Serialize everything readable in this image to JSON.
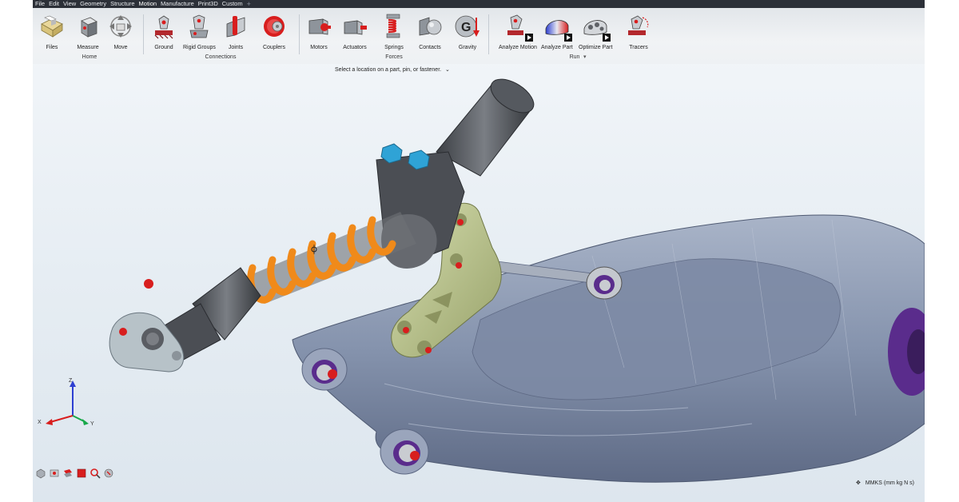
{
  "menubar": {
    "items": [
      "File",
      "Edit",
      "View",
      "Geometry",
      "Structure",
      "Motion",
      "Manufacture",
      "Print3D",
      "Custom"
    ],
    "active": "Motion"
  },
  "ribbon": {
    "home": {
      "label": "Home",
      "tools": [
        {
          "label": "Files",
          "icon": "files-icon"
        },
        {
          "label": "Measure",
          "icon": "measure-icon"
        },
        {
          "label": "Move",
          "icon": "move-icon"
        }
      ]
    },
    "connections": {
      "label": "Connections",
      "tools": [
        {
          "label": "Ground",
          "icon": "ground-icon"
        },
        {
          "label": "Rigid Groups",
          "icon": "rigid-groups-icon"
        },
        {
          "label": "Joints",
          "icon": "joints-icon"
        },
        {
          "label": "Couplers",
          "icon": "couplers-icon"
        }
      ]
    },
    "forces": {
      "label": "Forces",
      "tools": [
        {
          "label": "Motors",
          "icon": "motors-icon"
        },
        {
          "label": "Actuators",
          "icon": "actuators-icon"
        },
        {
          "label": "Springs",
          "icon": "springs-icon"
        },
        {
          "label": "Contacts",
          "icon": "contacts-icon"
        },
        {
          "label": "Gravity",
          "icon": "gravity-icon"
        }
      ]
    },
    "run": {
      "label": "Run",
      "tools": [
        {
          "label": "Analyze Motion",
          "icon": "analyze-motion-icon"
        },
        {
          "label": "Analyze Part",
          "icon": "analyze-part-icon"
        },
        {
          "label": "Optimize Part",
          "icon": "optimize-part-icon"
        },
        {
          "label": "Tracers",
          "icon": "tracers-icon"
        }
      ]
    }
  },
  "prompt": {
    "text": "Select a location on a part, pin, or fastener."
  },
  "status": {
    "units": "MMKS (mm kg N s)"
  },
  "triad": {
    "z": "Z",
    "x": "X",
    "y": "Y"
  },
  "colors": {
    "spring": "#f08a1a",
    "bracket": "#b9c48a",
    "swingarm": "#8593ad",
    "bushing": "#5a2c8c",
    "fastener": "#2fa3d6",
    "pin": "#d81e1e"
  }
}
